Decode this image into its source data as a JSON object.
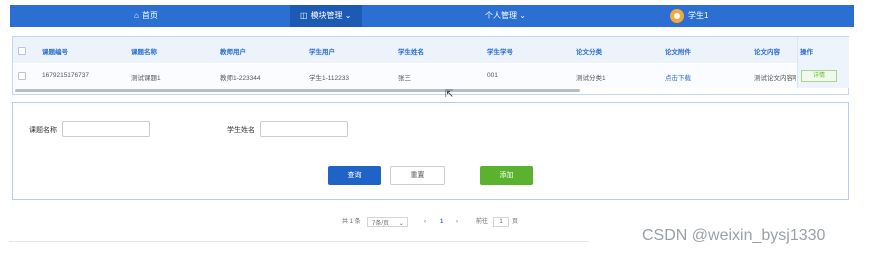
{
  "nav": {
    "home_icon": "home-icon",
    "home_label": "首页",
    "module_icon": "module-icon",
    "module_label": "模块管理",
    "module_chevron": "⌄",
    "personal_label": "个人管理",
    "personal_chevron": "⌄",
    "user_name": "学生1"
  },
  "table": {
    "headers": [
      "课题编号",
      "课题名称",
      "教师用户",
      "学生用户",
      "学生姓名",
      "学生学号",
      "论文分类",
      "论文附件",
      "论文内容",
      "操作"
    ],
    "row": {
      "course_no": "1679215176737",
      "course_name": "测试课题1",
      "teacher_user": "教师1-223344",
      "student_user": "学生1-112233",
      "student_name": "张三",
      "student_no": "001",
      "paper_category": "测试分类1",
      "attachment_link": "点击下载",
      "paper_content": "测试论文内容啊",
      "detail_button": "详情"
    }
  },
  "search": {
    "course_name_label": "课题名称",
    "course_name_value": "",
    "student_name_label": "学生姓名",
    "student_name_value": "",
    "query_button": "查询",
    "reset_button": "重置",
    "add_button": "添加"
  },
  "pagination": {
    "total": "共 1 条",
    "page_size": "7条/页",
    "page_size_chevron": "⌄",
    "prev": "‹",
    "current_page": "1",
    "next": "›",
    "goto_label": "前往",
    "goto_value": "1",
    "page_unit": "页"
  },
  "watermark": "CSDN @weixin_bysj1330",
  "colors": {
    "nav_bg": "#2a6fd1",
    "primary": "#1f63c6",
    "success": "#5ab22f"
  }
}
